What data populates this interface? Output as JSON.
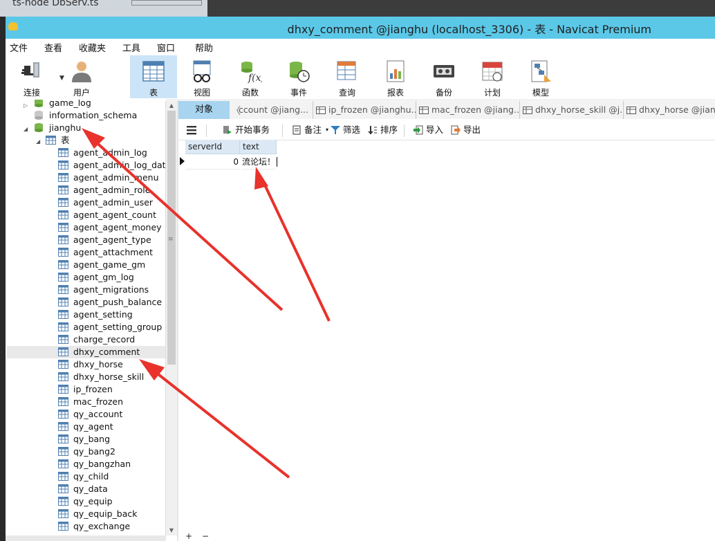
{
  "background": {
    "title_fragment": "ts-node  DbServ.ts"
  },
  "window": {
    "title": "dhxy_comment @jianghu (localhost_3306) - 表 - Navicat Premium"
  },
  "menu": [
    "文件",
    "查看",
    "收藏夹",
    "工具",
    "窗口",
    "帮助"
  ],
  "toolbar": {
    "connect": "连接",
    "user": "用户",
    "table": "表",
    "view": "视图",
    "function": "函数",
    "event": "事件",
    "query": "查询",
    "report": "报表",
    "backup": "备份",
    "schedule": "计划",
    "model": "模型"
  },
  "tree": {
    "databases": {
      "game_log": "game_log",
      "information_schema": "information_schema",
      "jianghu": "jianghu"
    },
    "tables_group": "表",
    "tables": [
      "agent_admin_log",
      "agent_admin_log_data",
      "agent_admin_menu",
      "agent_admin_role",
      "agent_admin_user",
      "agent_agent_count",
      "agent_agent_money",
      "agent_agent_type",
      "agent_attachment",
      "agent_game_gm",
      "agent_gm_log",
      "agent_migrations",
      "agent_push_balance",
      "agent_setting",
      "agent_setting_group",
      "charge_record",
      "dhxy_comment",
      "dhxy_horse",
      "dhxy_horse_skill",
      "ip_frozen",
      "mac_frozen",
      "qy_account",
      "qy_agent",
      "qy_bang",
      "qy_bang2",
      "qy_bangzhan",
      "qy_child",
      "qy_data",
      "qy_equip",
      "qy_equip_back",
      "qy_exchange"
    ],
    "selected": "dhxy_comment"
  },
  "tabs": {
    "objects": "对象",
    "open": [
      "ccount @jiang...",
      "ip_frozen @jianghu...",
      "mac_frozen @jiang...",
      "dhxy_horse_skill @j...",
      "dhxy_horse @jiang..."
    ]
  },
  "subtoolbar": {
    "begin_transaction": "开始事务",
    "note": "备注",
    "filter": "筛选",
    "sort": "排序",
    "import": "导入",
    "export": "导出"
  },
  "grid": {
    "columns": [
      "serverId",
      "text"
    ],
    "rows": [
      {
        "serverId": "0",
        "text": "流论坛！"
      }
    ]
  },
  "colors": {
    "titlebar": "#5bc8e8",
    "active_tool": "#cce4f7",
    "object_tab": "#a8d4ef",
    "annotation_arrow": "#e8322b"
  }
}
